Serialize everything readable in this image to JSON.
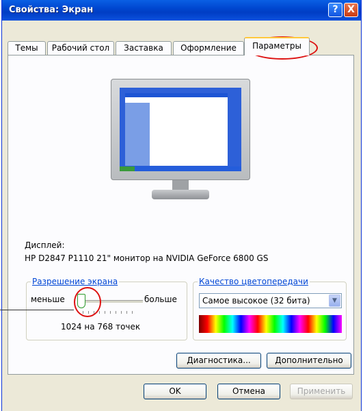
{
  "window": {
    "title": "Свойства: Экран",
    "help_glyph": "?",
    "close_glyph": "X"
  },
  "tabs": [
    {
      "label": "Темы"
    },
    {
      "label": "Рабочий стол"
    },
    {
      "label": "Заставка"
    },
    {
      "label": "Оформление"
    },
    {
      "label": "Параметры",
      "active": true
    }
  ],
  "display": {
    "label": "Дисплей:",
    "value": "HP D2847 P1110 21\" монитор на NVIDIA GeForce 6800 GS"
  },
  "resolution": {
    "title": "Разрешение экрана",
    "less_label": "меньше",
    "more_label": "больше",
    "value_text": "1024 на 768 точек",
    "slider_level_percent": 0
  },
  "color_quality": {
    "title": "Качество цветопередачи",
    "selected": "Самое высокое (32 бита)"
  },
  "buttons": {
    "diagnostics": "Диагностика...",
    "advanced": "Дополнительно",
    "ok": "OK",
    "cancel": "Отмена",
    "apply": "Применить"
  },
  "colors": {
    "titlebar": "#0054E3",
    "dialog_bg": "#ECE9D8",
    "panel_bg": "#FCFCFE",
    "group_title": "#0046D5",
    "highlight": "#DD1111"
  }
}
